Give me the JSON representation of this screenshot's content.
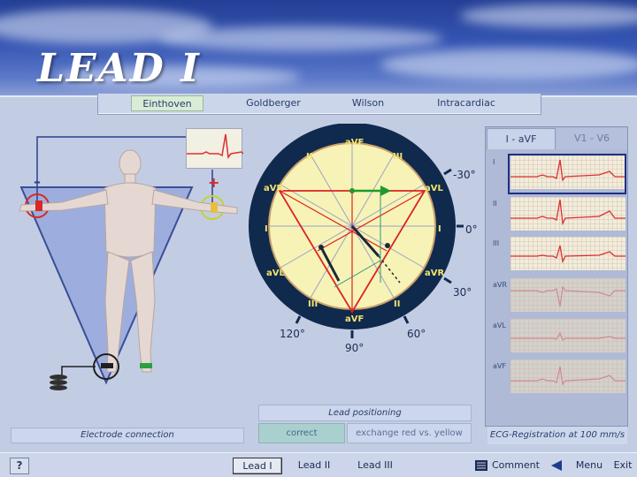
{
  "title": "LEAD I",
  "tabs": [
    "Einthoven",
    "Goldberger",
    "Wilson",
    "Intracardiac"
  ],
  "active_tab": "Einthoven",
  "electrodes": {
    "negative": "–",
    "positive": "+"
  },
  "diagram": {
    "top_label": "aVF",
    "bottom_label": "aVF",
    "left_labels": [
      "II",
      "aVR",
      "I",
      "aVL",
      "III"
    ],
    "right_labels": [
      "III",
      "aVL",
      "I",
      "aVR",
      "II"
    ],
    "angles": [
      "-30°",
      "0°",
      "30°",
      "60°",
      "90°",
      "120°"
    ]
  },
  "ecg_panel": {
    "tabs": [
      "I - aVF",
      "V1 - V6"
    ],
    "rows": [
      "I",
      "II",
      "III",
      "aVR",
      "aVL",
      "aVF"
    ],
    "selected": "I",
    "footer": "ECG-Registration at 100 mm/s"
  },
  "electrode_connection_label": "Electrode connection",
  "lead_positioning": {
    "label": "Lead positioning",
    "correct": "correct",
    "exchange": "exchange red vs. yellow"
  },
  "bottom_bar": {
    "help": "?",
    "leads": [
      "Lead I",
      "Lead II",
      "Lead III"
    ],
    "comment": "Comment",
    "menu": "Menu",
    "exit": "Exit"
  },
  "colors": {
    "dark_ring": "#102a4e",
    "inner_circle": "#f7f3b6",
    "triangle_red": "#dd2222",
    "axis_green": "#1f9a2a",
    "ecg_trace": "#dd2f2f",
    "label_yellow": "#f2e46a"
  }
}
